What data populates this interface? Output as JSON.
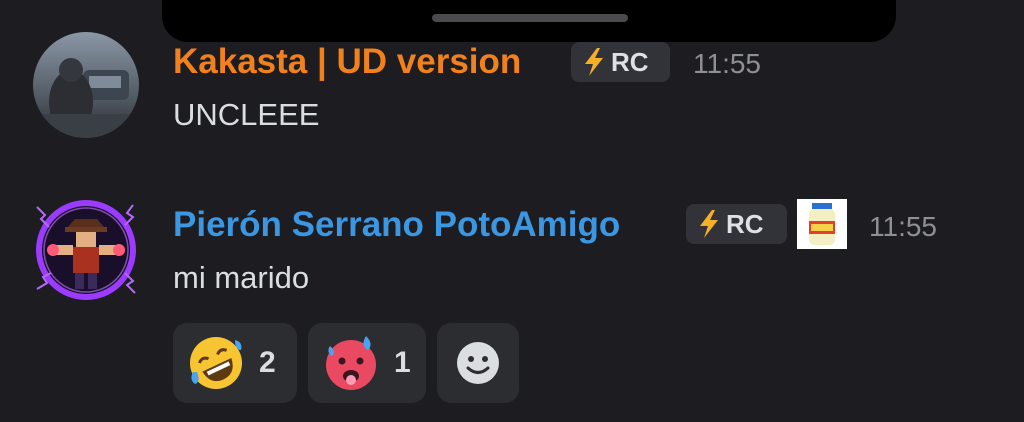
{
  "messages": [
    {
      "author": "Kakasta | UD version",
      "author_color": "#f0811d",
      "badge_label": "RC",
      "time": "11:55",
      "content": "UNCLEEE"
    },
    {
      "author": "Pierón Serrano PotoAmigo",
      "author_color": "#3b97e1",
      "badge_label": "RC",
      "time": "11:55",
      "content": "mi marido",
      "reactions": [
        {
          "emoji": "rolling-on-floor-laughing",
          "count": "2"
        },
        {
          "emoji": "hot-face-sweat",
          "count": "1"
        }
      ]
    }
  ]
}
